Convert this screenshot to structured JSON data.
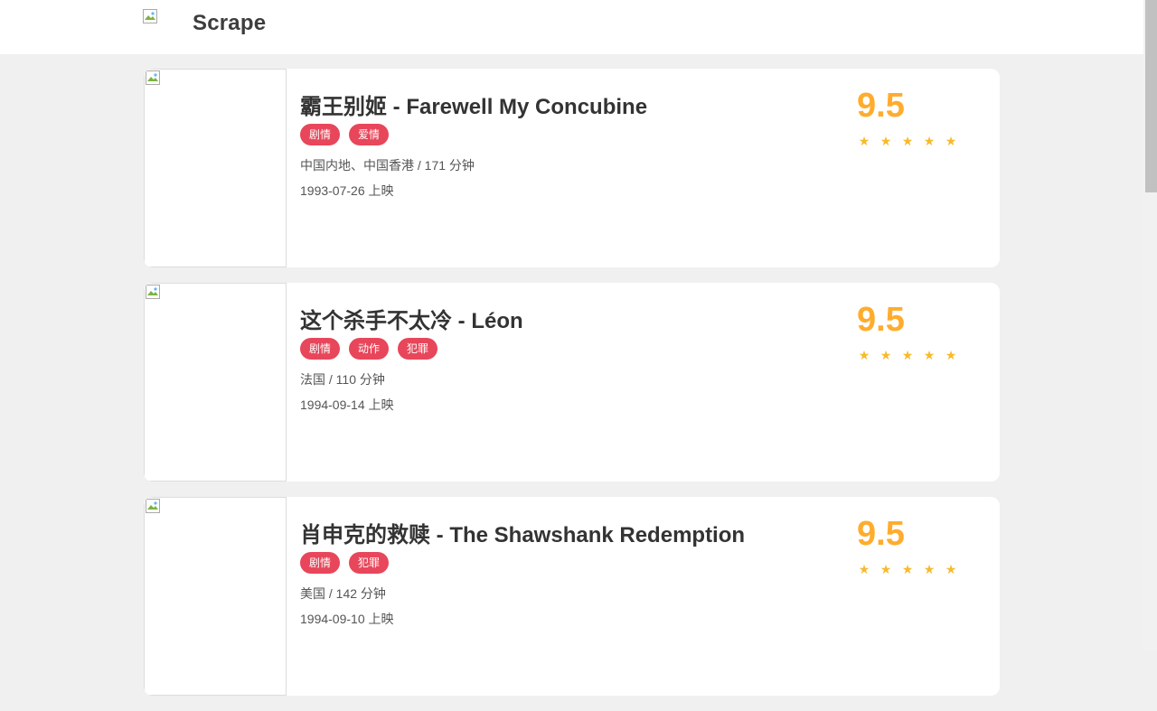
{
  "header": {
    "site_title": "Scrape",
    "logo_icon": "broken-image-icon"
  },
  "movies": [
    {
      "name": "霸王别姬 - Farewell My Concubine",
      "tags": [
        "剧情",
        "爱情"
      ],
      "info": "中国内地、中国香港 / 171 分钟",
      "release": "1993-07-26 上映",
      "score": "9.5",
      "stars": 5
    },
    {
      "name": "这个杀手不太冷 - Léon",
      "tags": [
        "剧情",
        "动作",
        "犯罪"
      ],
      "info": "法国 / 110 分钟",
      "release": "1994-09-14 上映",
      "score": "9.5",
      "stars": 5
    },
    {
      "name": "肖申克的救赎 - The Shawshank Redemption",
      "tags": [
        "剧情",
        "犯罪"
      ],
      "info": "美国 / 142 分钟",
      "release": "1994-09-10 上映",
      "score": "9.5",
      "stars": 5
    }
  ],
  "colors": {
    "tag_bg": "#e8465a",
    "score": "#ffac2d",
    "star": "#f7ba2a"
  }
}
